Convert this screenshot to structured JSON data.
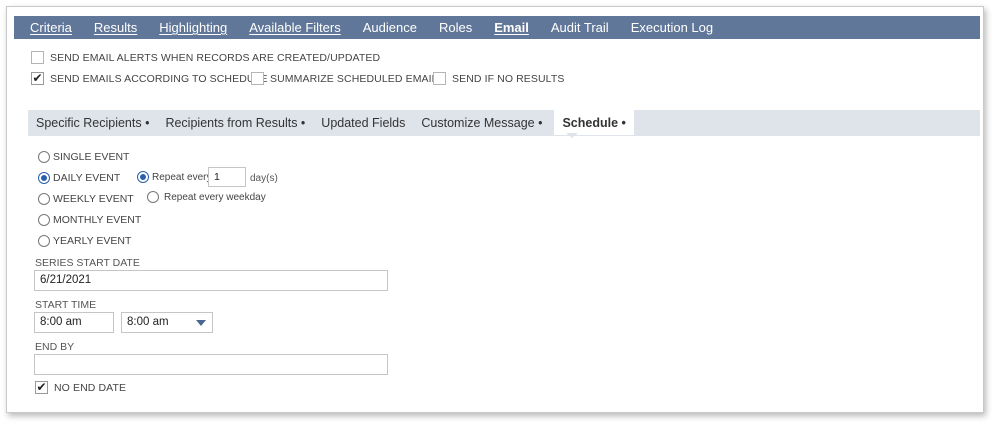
{
  "top_tabs": [
    {
      "label": "Criteria"
    },
    {
      "label": "Results"
    },
    {
      "label": "Highlighting"
    },
    {
      "label": "Available Filters"
    },
    {
      "label": "Audience"
    },
    {
      "label": "Roles"
    },
    {
      "label": "Email"
    },
    {
      "label": "Audit Trail"
    },
    {
      "label": "Execution Log"
    }
  ],
  "email_options": {
    "alerts_label": "SEND EMAIL ALERTS WHEN RECORDS ARE CREATED/UPDATED",
    "alerts_checked": false,
    "schedule_label": "SEND EMAILS ACCORDING TO SCHEDULE",
    "schedule_checked": true,
    "summarize_label": "SUMMARIZE SCHEDULED EMAILS",
    "summarize_checked": false,
    "no_results_label": "SEND IF NO RESULTS",
    "no_results_checked": false
  },
  "sub_tabs": [
    {
      "label": "Specific Recipients •"
    },
    {
      "label": "Recipients from Results •"
    },
    {
      "label": "Updated Fields"
    },
    {
      "label": "Customize Message •"
    },
    {
      "label": "Schedule •"
    }
  ],
  "schedule": {
    "single_event": "SINGLE EVENT",
    "daily_event": "DAILY EVENT",
    "weekly_event": "WEEKLY EVENT",
    "monthly_event": "MONTHLY EVENT",
    "yearly_event": "YEARLY EVENT",
    "selected": "DAILY EVENT",
    "repeat_every_label": "Repeat every",
    "repeat_every_value": "1",
    "repeat_unit": "day(s)",
    "repeat_weekday_label": "Repeat every weekday",
    "series_start_label": "SERIES START DATE",
    "series_start_value": "6/21/2021",
    "start_time_label": "START TIME",
    "start_time_value": "8:00 am",
    "start_time_select": "8:00 am",
    "end_by_label": "END BY",
    "end_by_value": "",
    "no_end_date_label": "NO END DATE",
    "no_end_date_checked": true
  },
  "icons": {
    "checkmark": "checkmark-icon",
    "dropdown": "chevron-down-icon"
  },
  "colors": {
    "tab_bar": "#607799",
    "subtab_bar": "#dfe4eb",
    "radio_accent": "#2a5fae"
  }
}
